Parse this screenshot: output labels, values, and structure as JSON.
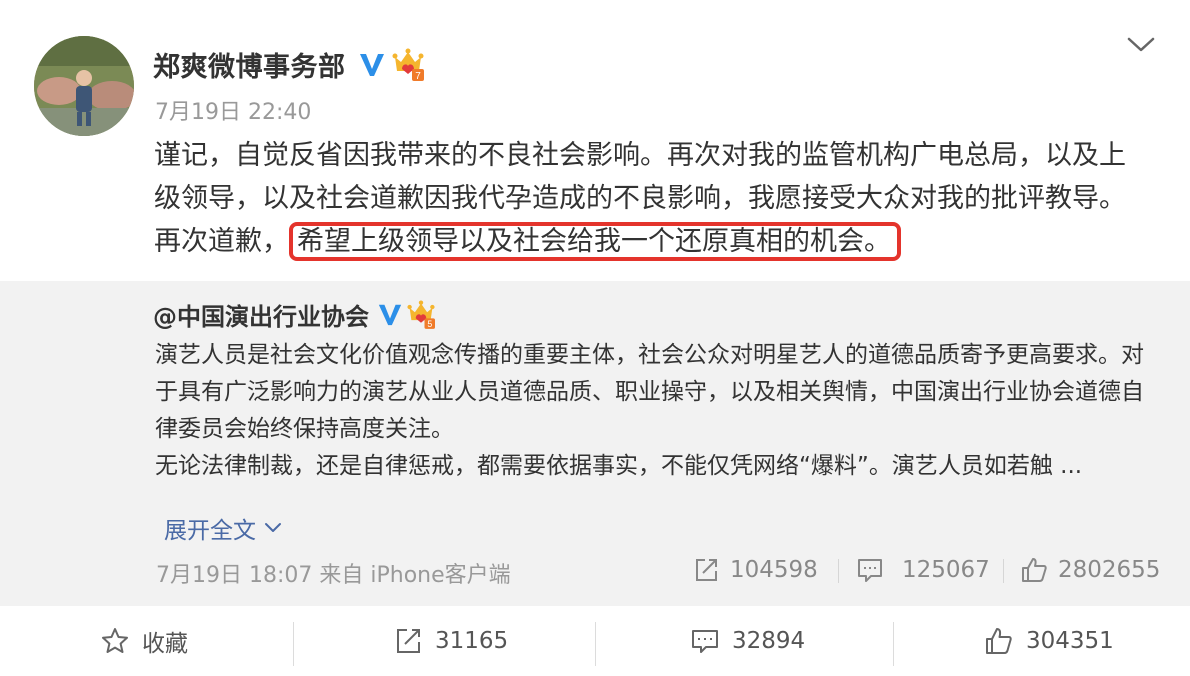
{
  "post": {
    "username": "郑爽微博事务部",
    "crown_level": "7",
    "time": "7月19日 22:40",
    "content_main": "谨记，自觉反省因我带来的不良社会影响。再次对我的监管机构广电总局，以及上级领导，以及社会道歉因我代孕造成的不良影响，我愿接受大众对我的批评教导。再次道歉，",
    "content_highlight": "希望上级领导以及社会给我一个还原真相的机会。"
  },
  "repost": {
    "author": "@中国演出行业协会",
    "crown_level": "5",
    "paragraph1": "演艺人员是社会文化价值观念传播的重要主体，社会公众对明星艺人的道德品质寄予更高要求。对于具有广泛影响力的演艺从业人员道德品质、职业操守，以及相关舆情，中国演出行业协会道德自律委员会始终保持高度关注。",
    "paragraph2": "无论法律制裁，还是自律惩戒，都需要依据事实，不能仅凭网络“爆料”。演艺人员如若触 ...",
    "expand_label": "展开全文",
    "time_source": "7月19日 18:07 来自 iPhone客户端",
    "reposts": "104598",
    "comments": "125067",
    "likes": "2802655"
  },
  "actions": {
    "favorite_label": "收藏",
    "reposts": "31165",
    "comments": "32894",
    "likes": "304351"
  },
  "colors": {
    "verify_blue": "#2c8fe8",
    "highlight_red": "#e4342c",
    "link_blue": "#4a6aa6",
    "repost_bg": "#f2f2f2"
  }
}
